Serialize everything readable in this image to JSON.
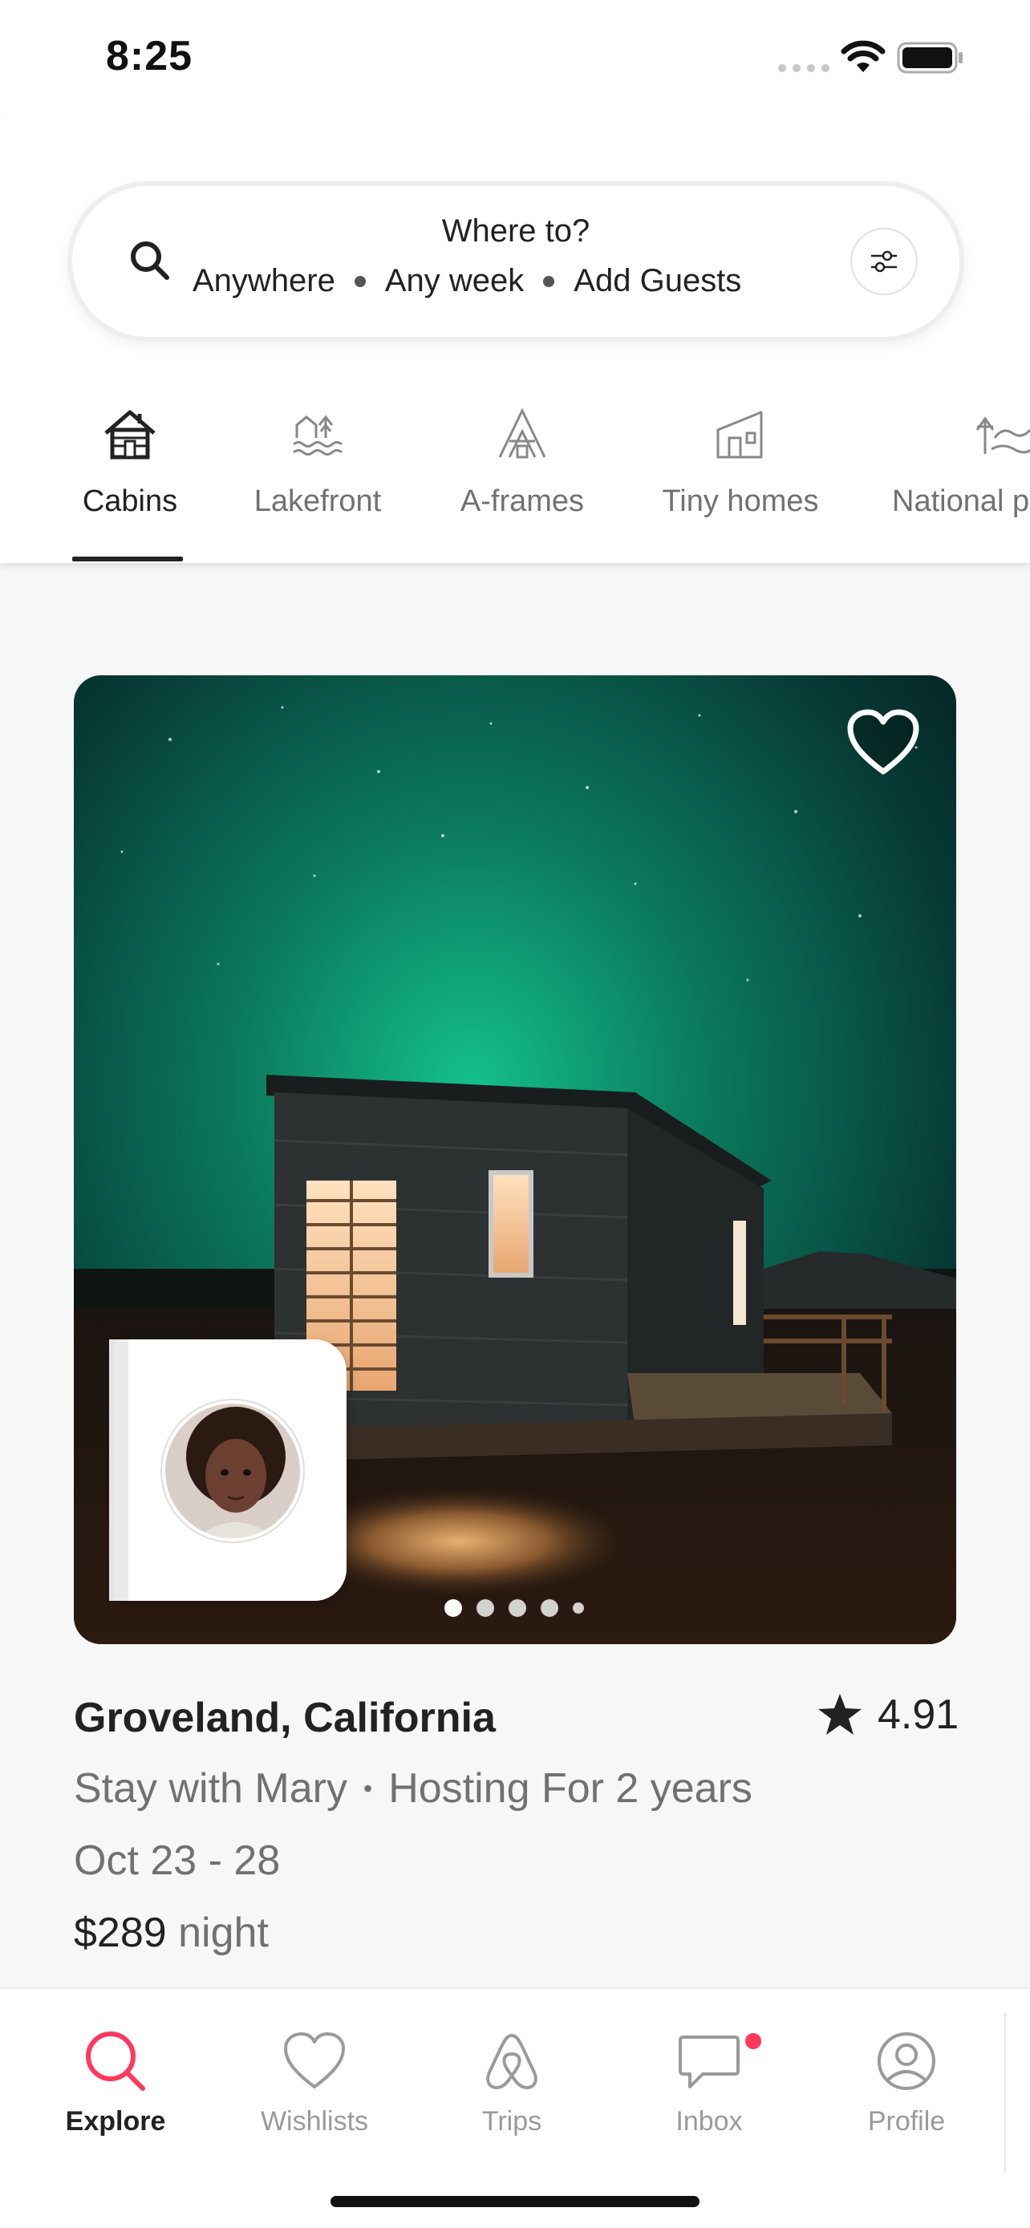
{
  "status_bar": {
    "time": "8:25"
  },
  "search": {
    "title": "Where to?",
    "location": "Anywhere",
    "dates": "Any week",
    "guests": "Add Guests"
  },
  "categories": [
    {
      "label": "Cabins",
      "icon": "cabin-icon",
      "active": true
    },
    {
      "label": "Lakefront",
      "icon": "lakefront-icon",
      "active": false
    },
    {
      "label": "A-frames",
      "icon": "a-frame-icon",
      "active": false
    },
    {
      "label": "Tiny homes",
      "icon": "tiny-home-icon",
      "active": false
    },
    {
      "label": "National p",
      "icon": "national-park-icon",
      "active": false
    }
  ],
  "listing": {
    "location": "Groveland, California",
    "rating": "4.91",
    "host": "Stay with Mary",
    "hosting": "Hosting For 2 years",
    "dates": "Oct 23 - 28",
    "price": "$289",
    "price_unit": "night",
    "photo_count": 5,
    "active_photo": 0
  },
  "tabs": [
    {
      "label": "Explore",
      "icon": "search-icon",
      "active": true
    },
    {
      "label": "Wishlists",
      "icon": "heart-icon",
      "active": false
    },
    {
      "label": "Trips",
      "icon": "airbnb-logo-icon",
      "active": false
    },
    {
      "label": "Inbox",
      "icon": "message-icon",
      "active": false,
      "badge": true
    },
    {
      "label": "Profile",
      "icon": "user-circle-icon",
      "active": false
    }
  ],
  "colors": {
    "accent": "#ff385c",
    "text": "#222222",
    "muted": "#717171"
  }
}
